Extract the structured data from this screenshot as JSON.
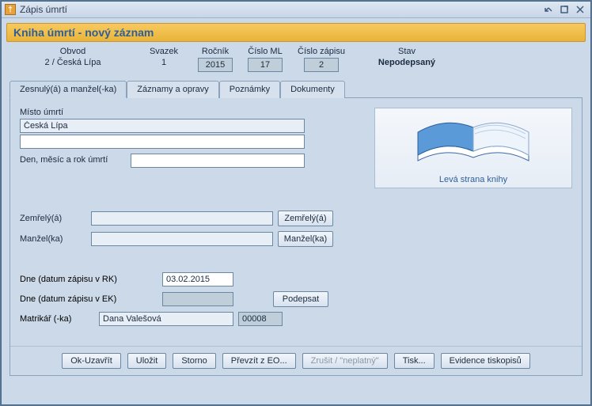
{
  "window": {
    "title": "Zápis úmrtí",
    "icon_glyph": "†"
  },
  "banner": "Kniha úmrtí - nový záznam",
  "header": {
    "labels": {
      "obvod": "Obvod",
      "svazek": "Svazek",
      "rocnik": "Ročník",
      "cislo_ml": "Číslo ML",
      "cislo_zapisu": "Číslo zápisu",
      "stav": "Stav"
    },
    "values": {
      "obvod": "2 / Česká Lípa",
      "svazek": "1",
      "rocnik": "2015",
      "cislo_ml": "17",
      "cislo_zapisu": "2",
      "stav": "Nepodepsaný"
    }
  },
  "tabs": [
    {
      "label": "Zesnulý(á) a manžel(-ka)",
      "active": true
    },
    {
      "label": "Záznamy a opravy",
      "active": false
    },
    {
      "label": "Poznámky",
      "active": false
    },
    {
      "label": "Dokumenty",
      "active": false
    }
  ],
  "panel": {
    "misto_label": "Místo úmrtí",
    "misto_value": "Česká Lípa",
    "misto_value2": "",
    "datum_umrti_label": "Den, měsíc a rok úmrtí",
    "datum_umrti_value": "",
    "book_caption": "Levá strana knihy",
    "zemrely_label": "Zemřelý(á)",
    "zemrely_value": "",
    "zemrely_btn": "Zemřelý(á)",
    "manzel_label": "Manžel(ka)",
    "manzel_value": "",
    "manzel_btn": "Manžel(ka)",
    "dne_rk_label": "Dne (datum zápisu v RK)",
    "dne_rk_value": "03.02.2015",
    "dne_ek_label": "Dne (datum zápisu v EK)",
    "dne_ek_value": "",
    "podepsat_btn": "Podepsat",
    "matrikar_label": "Matrikář (-ka)",
    "matrikar_name": "Dana Valešová",
    "matrikar_code": "00008"
  },
  "buttons": {
    "ok": "Ok-Uzavřít",
    "ulozit": "Uložit",
    "storno": "Storno",
    "prevzit": "Převzít z EO...",
    "zrusit": "Zrušit / \"neplatný\"",
    "tisk": "Tisk...",
    "evidence": "Evidence tiskopisů"
  }
}
